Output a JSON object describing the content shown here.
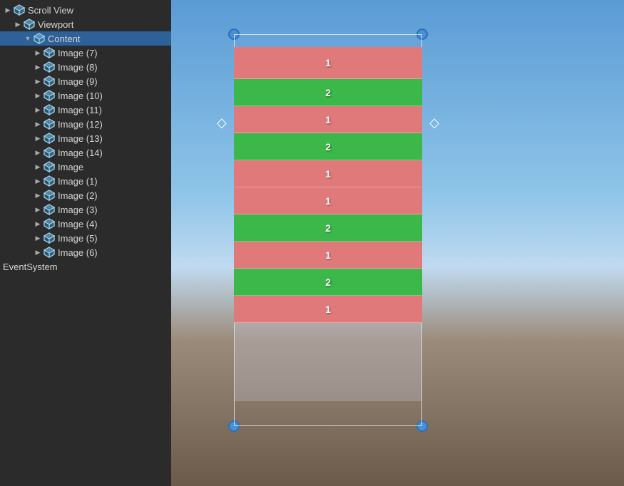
{
  "leftPanel": {
    "items": [
      {
        "id": "scroll-view",
        "label": "Scroll View",
        "indent": 0,
        "arrow": "▶",
        "hasArrow": true,
        "icon": true
      },
      {
        "id": "viewport",
        "label": "Viewport",
        "indent": 1,
        "arrow": "▶",
        "hasArrow": true,
        "icon": true
      },
      {
        "id": "content",
        "label": "Content",
        "indent": 2,
        "arrow": "▼",
        "hasArrow": true,
        "icon": true,
        "selected": true
      },
      {
        "id": "image7",
        "label": "Image (7)",
        "indent": 3,
        "arrow": "▶",
        "hasArrow": true,
        "icon": true
      },
      {
        "id": "image8",
        "label": "Image (8)",
        "indent": 3,
        "arrow": "▶",
        "hasArrow": true,
        "icon": true
      },
      {
        "id": "image9",
        "label": "Image (9)",
        "indent": 3,
        "arrow": "▶",
        "hasArrow": true,
        "icon": true
      },
      {
        "id": "image10",
        "label": "Image (10)",
        "indent": 3,
        "arrow": "▶",
        "hasArrow": true,
        "icon": true
      },
      {
        "id": "image11",
        "label": "Image (11)",
        "indent": 3,
        "arrow": "▶",
        "hasArrow": true,
        "icon": true
      },
      {
        "id": "image12",
        "label": "Image (12)",
        "indent": 3,
        "arrow": "▶",
        "hasArrow": true,
        "icon": true
      },
      {
        "id": "image13",
        "label": "Image (13)",
        "indent": 3,
        "arrow": "▶",
        "hasArrow": true,
        "icon": true
      },
      {
        "id": "image14",
        "label": "Image (14)",
        "indent": 3,
        "arrow": "▶",
        "hasArrow": true,
        "icon": true
      },
      {
        "id": "image",
        "label": "Image",
        "indent": 3,
        "arrow": "▶",
        "hasArrow": true,
        "icon": true
      },
      {
        "id": "image1",
        "label": "Image (1)",
        "indent": 3,
        "arrow": "▶",
        "hasArrow": true,
        "icon": true
      },
      {
        "id": "image2",
        "label": "Image (2)",
        "indent": 3,
        "arrow": "▶",
        "hasArrow": true,
        "icon": true
      },
      {
        "id": "image3",
        "label": "Image (3)",
        "indent": 3,
        "arrow": "▶",
        "hasArrow": true,
        "icon": true
      },
      {
        "id": "image4",
        "label": "Image (4)",
        "indent": 3,
        "arrow": "▶",
        "hasArrow": true,
        "icon": true
      },
      {
        "id": "image5",
        "label": "Image (5)",
        "indent": 3,
        "arrow": "▶",
        "hasArrow": true,
        "icon": true
      },
      {
        "id": "image6",
        "label": "Image (6)",
        "indent": 3,
        "arrow": "▶",
        "hasArrow": true,
        "icon": true
      }
    ],
    "eventSystem": "EventSystem"
  },
  "sceneView": {
    "rows": [
      {
        "type": "pink",
        "label": "1",
        "height": 45
      },
      {
        "type": "green",
        "label": "2",
        "height": 38
      },
      {
        "type": "pink",
        "label": "1",
        "height": 38
      },
      {
        "type": "green",
        "label": "2",
        "height": 38
      },
      {
        "type": "pink",
        "label": "1",
        "height": 38
      },
      {
        "type": "pink",
        "label": "1",
        "height": 38
      },
      {
        "type": "green",
        "label": "2",
        "height": 38
      },
      {
        "type": "pink",
        "label": "1",
        "height": 38
      },
      {
        "type": "green",
        "label": "2",
        "height": 38
      },
      {
        "type": "pink",
        "label": "1",
        "height": 38
      }
    ]
  }
}
